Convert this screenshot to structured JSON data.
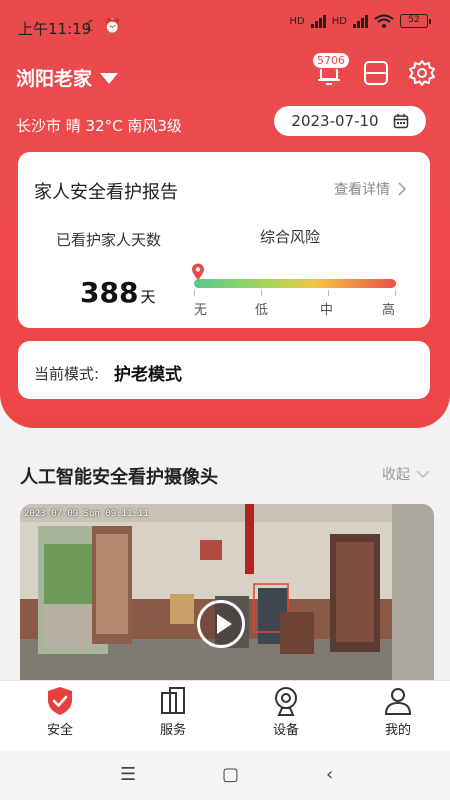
{
  "status_bar": {
    "time": "上午11:19",
    "network_left": "HD",
    "network_right": "HD",
    "battery": "52"
  },
  "header": {
    "location": "浏阳老家",
    "notification_count": "5706",
    "weather": "长沙市 晴 32°C 南风3级",
    "date": "2023-07-10"
  },
  "report": {
    "title": "家人安全看护报告",
    "detail_link": "查看详情",
    "days_label": "已看护家人天数",
    "days_value": "388",
    "days_unit": "天",
    "risk_label": "综合风险",
    "risk_levels": [
      "无",
      "低",
      "中",
      "高"
    ],
    "risk_level_current": 0
  },
  "mode": {
    "label": "当前模式:",
    "value": "护老模式"
  },
  "camera_section": {
    "title": "人工智能安全看护摄像头",
    "collapse_label": "收起",
    "timestamp": "2023-07-09 Sun 09:11:11"
  },
  "tabs": [
    {
      "label": "安全",
      "icon": "shield-check-icon",
      "active": true
    },
    {
      "label": "服务",
      "icon": "service-icon",
      "active": false
    },
    {
      "label": "设备",
      "icon": "camera-device-icon",
      "active": false
    },
    {
      "label": "我的",
      "icon": "user-icon",
      "active": false
    }
  ],
  "colors": {
    "brand_red": "#ea4a4c",
    "active_tab": "#e84040"
  }
}
